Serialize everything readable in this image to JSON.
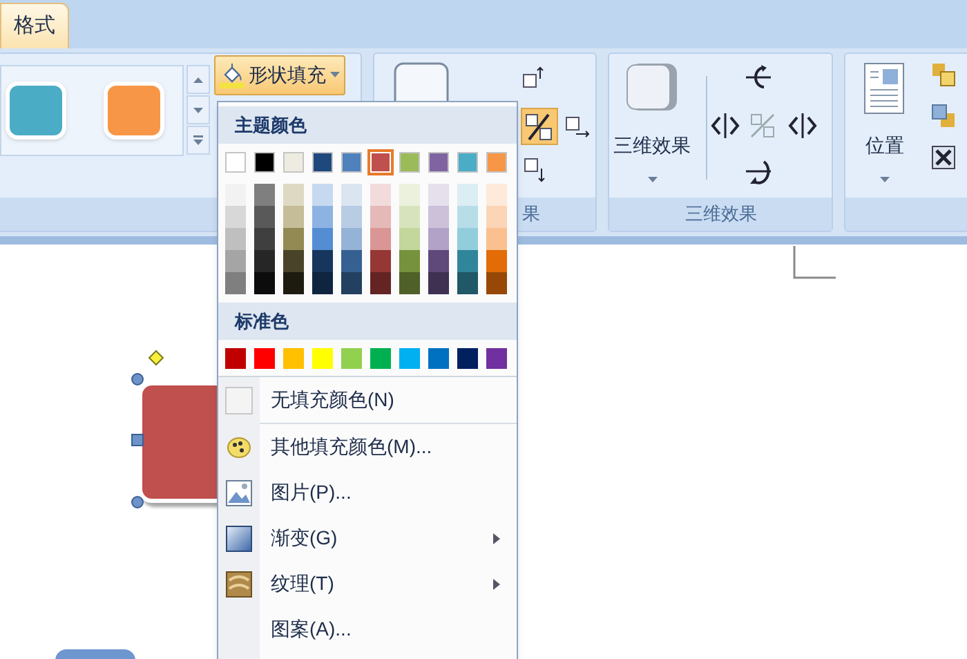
{
  "tabs": [
    {
      "label": "格式",
      "selected": true
    }
  ],
  "ribbon": {
    "shape_styles": {
      "gallery": [
        {
          "color": "#4bacc6"
        },
        {
          "color": "#f79646"
        }
      ],
      "fill_button": {
        "label": "形状填充",
        "expanded": true
      }
    },
    "shadow_effects": {
      "label": "果",
      "shadow_toggle": {
        "on": true
      }
    },
    "effects_3d": {
      "button": "三维效果",
      "label": "三维效果"
    },
    "arrange": {
      "button": "位置"
    }
  },
  "fill_menu": {
    "theme_header": "主题颜色",
    "theme_colors": [
      {
        "color": "#ffffff",
        "selected": false,
        "shades": [
          {
            "color": "#f2f2f2"
          },
          {
            "color": "#d8d8d8"
          },
          {
            "color": "#bfbfbf"
          },
          {
            "color": "#a5a5a5"
          },
          {
            "color": "#7f7f7f"
          }
        ]
      },
      {
        "color": "#000000",
        "selected": false,
        "shades": [
          {
            "color": "#7f7f7f"
          },
          {
            "color": "#595959"
          },
          {
            "color": "#3f3f3f"
          },
          {
            "color": "#262626"
          },
          {
            "color": "#0c0c0c"
          }
        ]
      },
      {
        "color": "#eeece1",
        "selected": false,
        "shades": [
          {
            "color": "#ddd9c3"
          },
          {
            "color": "#c4bd97"
          },
          {
            "color": "#938953"
          },
          {
            "color": "#494429"
          },
          {
            "color": "#1d1b10"
          }
        ]
      },
      {
        "color": "#1f497d",
        "selected": false,
        "shades": [
          {
            "color": "#c6d9f0"
          },
          {
            "color": "#8db3e2"
          },
          {
            "color": "#548dd4"
          },
          {
            "color": "#17365d"
          },
          {
            "color": "#0f243e"
          }
        ]
      },
      {
        "color": "#4f81bd",
        "selected": false,
        "shades": [
          {
            "color": "#dbe5f1"
          },
          {
            "color": "#b8cce4"
          },
          {
            "color": "#95b3d7"
          },
          {
            "color": "#366092"
          },
          {
            "color": "#244061"
          }
        ]
      },
      {
        "color": "#c0504d",
        "selected": true,
        "shades": [
          {
            "color": "#f2dcdb"
          },
          {
            "color": "#e5b9b7"
          },
          {
            "color": "#d99694"
          },
          {
            "color": "#953734"
          },
          {
            "color": "#632423"
          }
        ]
      },
      {
        "color": "#9bbb59",
        "selected": false,
        "shades": [
          {
            "color": "#ebf1dd"
          },
          {
            "color": "#d7e3bc"
          },
          {
            "color": "#c3d69b"
          },
          {
            "color": "#76923c"
          },
          {
            "color": "#4f6128"
          }
        ]
      },
      {
        "color": "#8064a2",
        "selected": false,
        "shades": [
          {
            "color": "#e5e0ec"
          },
          {
            "color": "#ccc1d9"
          },
          {
            "color": "#b2a2c7"
          },
          {
            "color": "#5f497a"
          },
          {
            "color": "#3f3151"
          }
        ]
      },
      {
        "color": "#4bacc6",
        "selected": false,
        "shades": [
          {
            "color": "#dbeef3"
          },
          {
            "color": "#b7dde8"
          },
          {
            "color": "#92cddc"
          },
          {
            "color": "#31859b"
          },
          {
            "color": "#205867"
          }
        ]
      },
      {
        "color": "#f79646",
        "selected": false,
        "shades": [
          {
            "color": "#fdeada"
          },
          {
            "color": "#fbd5b5"
          },
          {
            "color": "#fac08f"
          },
          {
            "color": "#e36c09"
          },
          {
            "color": "#974806"
          }
        ]
      }
    ],
    "standard_header": "标准色",
    "standard_colors": [
      {
        "color": "#c00000",
        "selected": false
      },
      {
        "color": "#ff0000",
        "selected": false
      },
      {
        "color": "#ffc000",
        "selected": false
      },
      {
        "color": "#ffff00",
        "selected": false
      },
      {
        "color": "#92d050",
        "selected": false
      },
      {
        "color": "#00b050",
        "selected": false
      },
      {
        "color": "#00b0f0",
        "selected": false
      },
      {
        "color": "#0070c0",
        "selected": false
      },
      {
        "color": "#002060",
        "selected": false
      },
      {
        "color": "#7030a0",
        "selected": false
      }
    ],
    "items": [
      {
        "label": "无填充颜色(N)",
        "kind": "no-fill",
        "submenu": false
      },
      {
        "label": "其他填充颜色(M)...",
        "kind": "palette",
        "submenu": false
      },
      {
        "label": "图片(P)...",
        "kind": "picture",
        "submenu": false
      },
      {
        "label": "渐变(G)",
        "kind": "gradient",
        "submenu": true
      },
      {
        "label": "纹理(T)",
        "kind": "texture",
        "submenu": true
      },
      {
        "label": "图案(A)...",
        "kind": "pattern",
        "submenu": false
      }
    ]
  },
  "canvas": {
    "shape": {
      "selected": true
    }
  }
}
